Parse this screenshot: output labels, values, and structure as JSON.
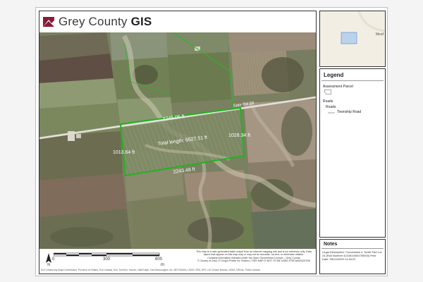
{
  "header": {
    "brand_light": "Grey County ",
    "brand_bold": "GIS",
    "accent_color": "#8b1a3a"
  },
  "map": {
    "icons": [
      "north-arrow-icon",
      "logo-icon"
    ],
    "parcel_color": "#1fb41f",
    "road_label": "Side Rd 24",
    "measurements": {
      "top": "2245.05 ft",
      "right": "1028.34 ft",
      "left": "1013.64 ft",
      "bottom": "2243.48 ft",
      "total": "Total length: 6527.51 ft"
    }
  },
  "scalebar": {
    "ticks": [
      "0",
      "300",
      "600"
    ],
    "unit": "m"
  },
  "disclaimer": {
    "lines": [
      "This map is a user generated static output from an Internet mapping site and is for reference only. Data",
      "layers that appear on this map may or may not be accurate, current, or otherwise reliable.",
      "Contains information licensed under the Open Government Licence – Grey County",
      "© County of Grey | © King's Printer for Ontario | THIS MAP IS NOT TO BE USED FOR NAVIGATION"
    ],
    "credits": "Esri Community Maps Contributors, Province of Ontario, Esri Canada, Esri, TomTom, Garmin, SafeGraph, GeoTechnologies, Inc, METI/NASA, USGS, EPA, NPS, US Census Bureau, USDA, NRCan, Parks Canada"
  },
  "inset": {
    "place_label": "Meaf"
  },
  "legend": {
    "title": "Legend",
    "assessment_parcel": "Assessment Parcel",
    "roads_group": "Roads",
    "roads_sub": "Roads",
    "township_road": "Township Road"
  },
  "notes": {
    "title": "Notes",
    "text": "Legal Description: Concession 4, North Part Lot 24 (Roll Number 4210810000709000) Print Date: 05/22/2025 14:46:22"
  }
}
